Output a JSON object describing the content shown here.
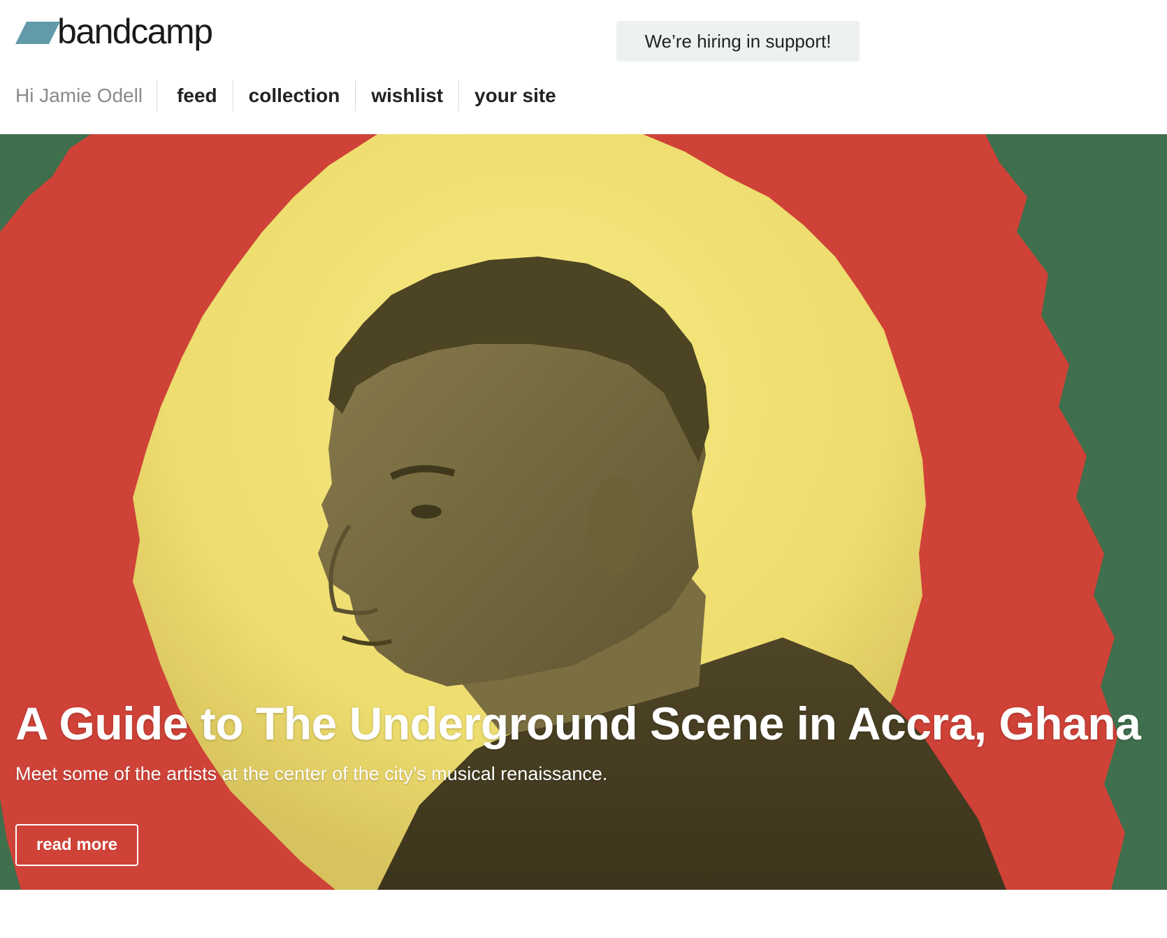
{
  "header": {
    "logo": {
      "icon": "bandcamp-logo-icon",
      "text": "bandcamp",
      "color": "#629aa9"
    },
    "hiring_banner": "We’re hiring in support!",
    "greeting": "Hi Jamie Odell",
    "nav": [
      {
        "label": "feed"
      },
      {
        "label": "collection"
      },
      {
        "label": "wishlist"
      },
      {
        "label": "your site"
      }
    ]
  },
  "hero": {
    "title": "A Guide to The Underground Scene in Accra, Ghana",
    "subtitle": "Meet some of the artists at the center of the city’s musical renaissance.",
    "button_label": "read more",
    "colors": {
      "background_green": "#3f6f4c",
      "ring_red": "#cf4237",
      "inner_yellow": "#f1e27a",
      "portrait_tone": "#6e6339"
    }
  }
}
